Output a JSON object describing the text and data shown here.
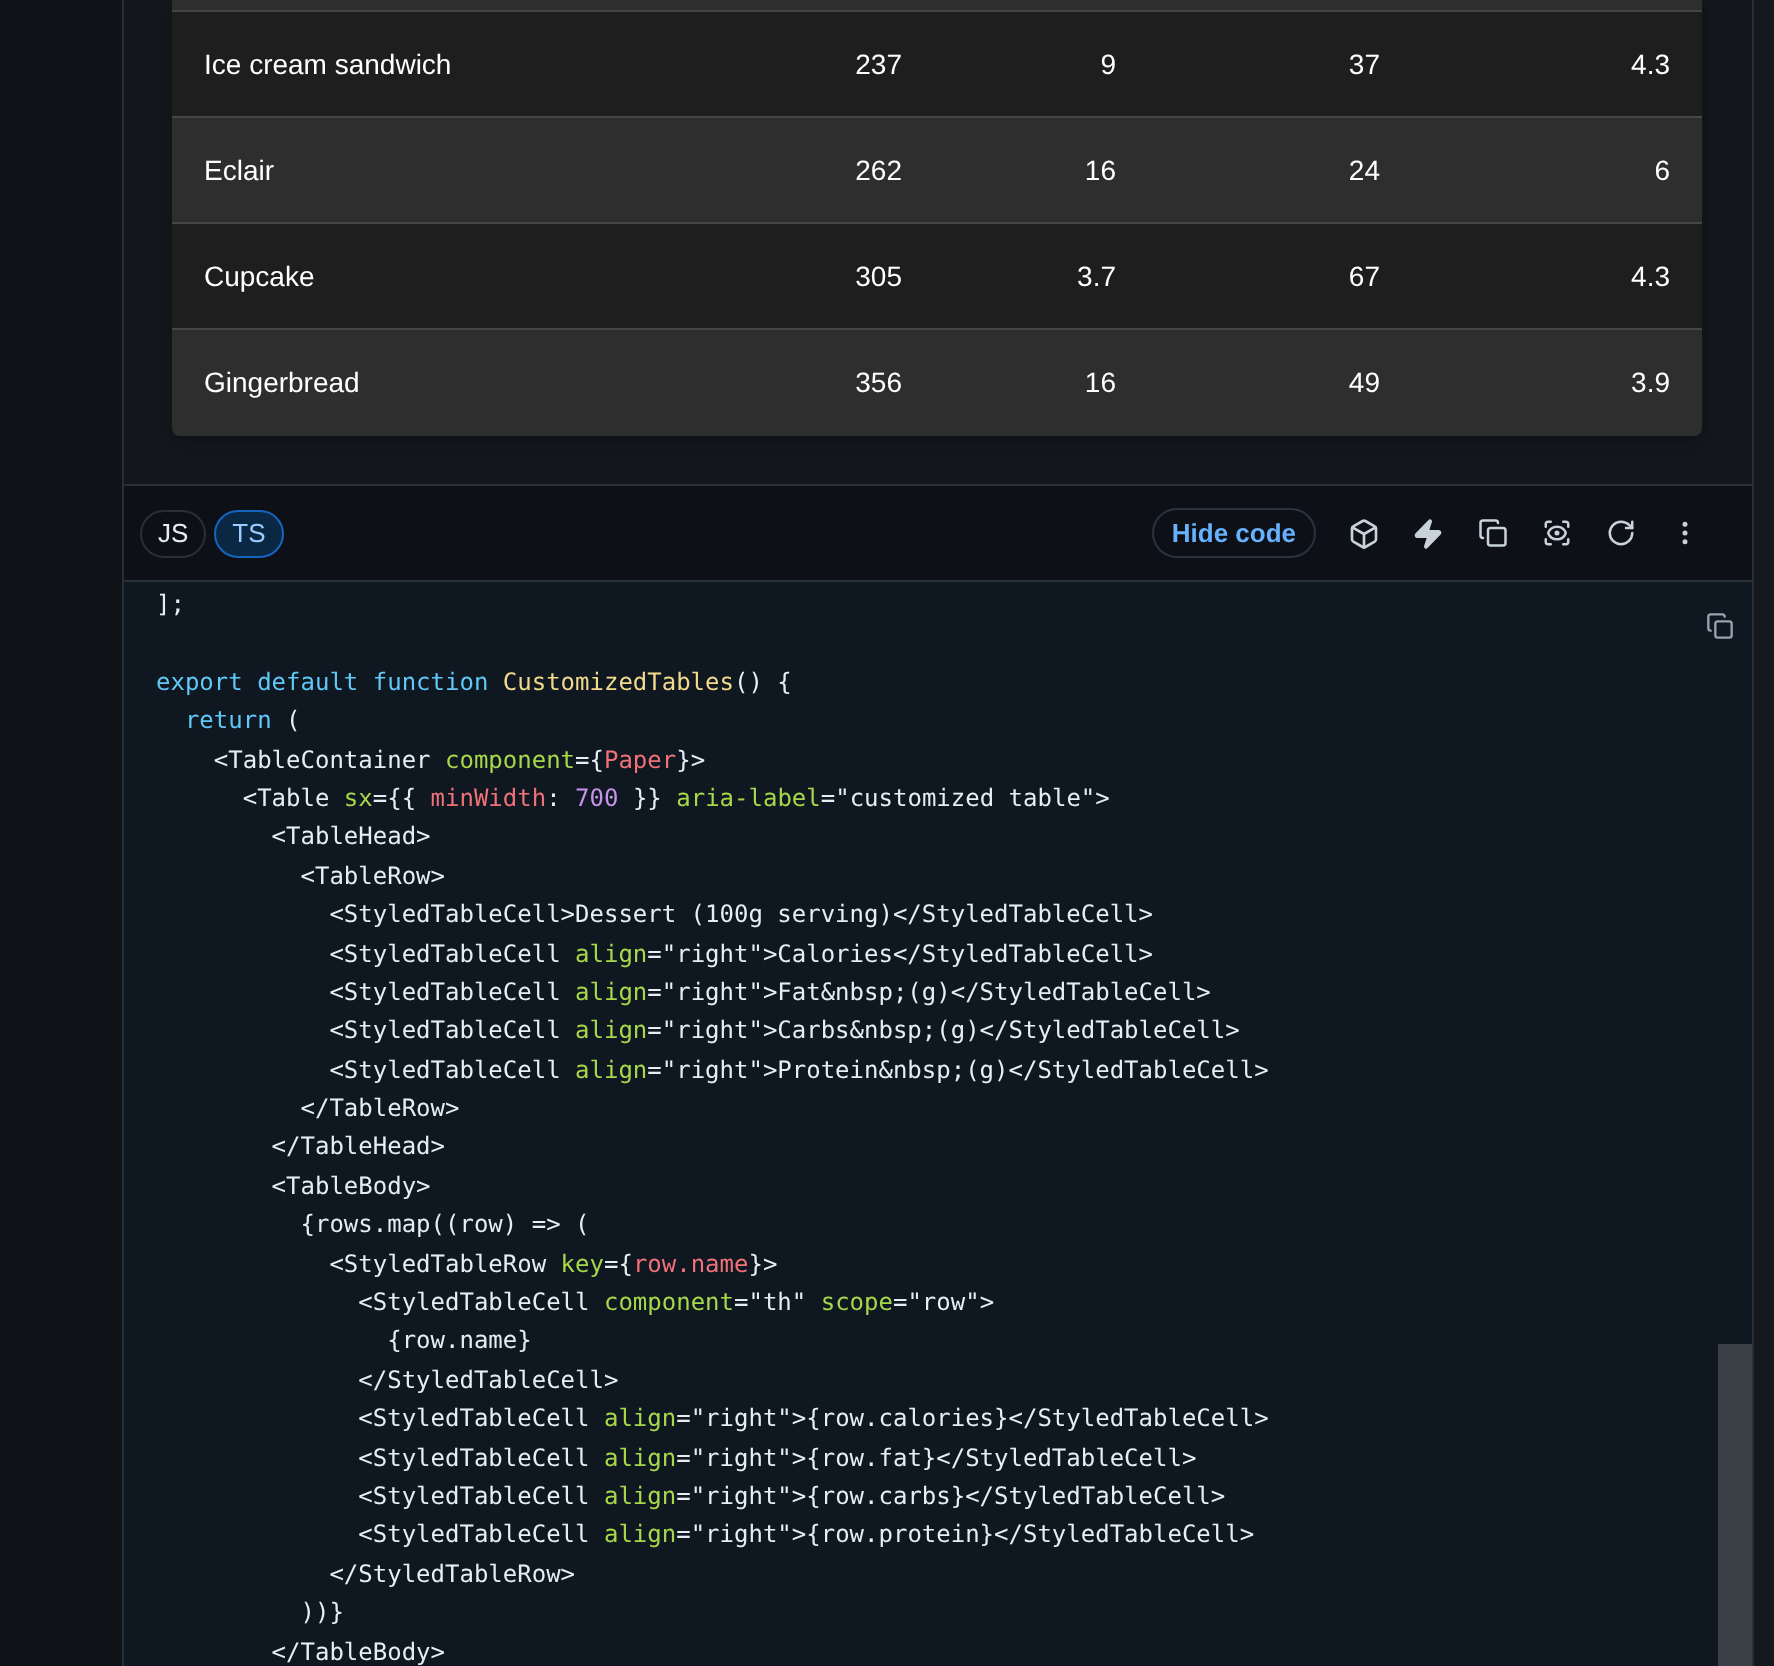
{
  "table": {
    "rows": [
      {
        "name": "Ice cream sandwich",
        "calories": "237",
        "fat": "9",
        "carbs": "37",
        "protein": "4.3"
      },
      {
        "name": "Eclair",
        "calories": "262",
        "fat": "16",
        "carbs": "24",
        "protein": "6"
      },
      {
        "name": "Cupcake",
        "calories": "305",
        "fat": "3.7",
        "carbs": "67",
        "protein": "4.3"
      },
      {
        "name": "Gingerbread",
        "calories": "356",
        "fat": "16",
        "carbs": "49",
        "protein": "3.9"
      }
    ]
  },
  "toolbar": {
    "languages": [
      {
        "label": "JS",
        "selected": false
      },
      {
        "label": "TS",
        "selected": true
      }
    ],
    "hide_code": "Hide code"
  },
  "code": {
    "lines": [
      [
        {
          "kind": "plain",
          "text": "];"
        }
      ],
      [
        {
          "kind": "blank"
        }
      ],
      [
        {
          "kind": "keyword",
          "text": "export default function "
        },
        {
          "kind": "fn",
          "text": "CustomizedTables"
        },
        {
          "kind": "plain",
          "text": "() {"
        }
      ],
      [
        {
          "kind": "keyword",
          "text": "  return "
        },
        {
          "kind": "plain",
          "text": "("
        }
      ],
      [
        {
          "kind": "plain",
          "text": "    <TableContainer "
        },
        {
          "kind": "attr",
          "text": "component"
        },
        {
          "kind": "plain",
          "text": "={"
        },
        {
          "kind": "var",
          "text": "Paper"
        },
        {
          "kind": "plain",
          "text": "}>"
        }
      ],
      [
        {
          "kind": "plain",
          "text": "      <Table "
        },
        {
          "kind": "attr",
          "text": "sx"
        },
        {
          "kind": "plain",
          "text": "={{ "
        },
        {
          "kind": "var",
          "text": "minWidth"
        },
        {
          "kind": "plain",
          "text": ": "
        },
        {
          "kind": "num",
          "text": "700"
        },
        {
          "kind": "plain",
          "text": " }} "
        },
        {
          "kind": "attr",
          "text": "aria-label"
        },
        {
          "kind": "plain",
          "text": "=\"customized table\">"
        }
      ],
      [
        {
          "kind": "plain",
          "text": "        <TableHead>"
        }
      ],
      [
        {
          "kind": "plain",
          "text": "          <TableRow>"
        }
      ],
      [
        {
          "kind": "plain",
          "text": "            <StyledTableCell>Dessert (100g serving)</StyledTableCell>"
        }
      ],
      [
        {
          "kind": "plain",
          "text": "            <StyledTableCell "
        },
        {
          "kind": "attr",
          "text": "align"
        },
        {
          "kind": "plain",
          "text": "=\"right\">Calories</StyledTableCell>"
        }
      ],
      [
        {
          "kind": "plain",
          "text": "            <StyledTableCell "
        },
        {
          "kind": "attr",
          "text": "align"
        },
        {
          "kind": "plain",
          "text": "=\"right\">Fat&nbsp;(g)</StyledTableCell>"
        }
      ],
      [
        {
          "kind": "plain",
          "text": "            <StyledTableCell "
        },
        {
          "kind": "attr",
          "text": "align"
        },
        {
          "kind": "plain",
          "text": "=\"right\">Carbs&nbsp;(g)</StyledTableCell>"
        }
      ],
      [
        {
          "kind": "plain",
          "text": "            <StyledTableCell "
        },
        {
          "kind": "attr",
          "text": "align"
        },
        {
          "kind": "plain",
          "text": "=\"right\">Protein&nbsp;(g)</StyledTableCell>"
        }
      ],
      [
        {
          "kind": "plain",
          "text": "          </TableRow>"
        }
      ],
      [
        {
          "kind": "plain",
          "text": "        </TableHead>"
        }
      ],
      [
        {
          "kind": "plain",
          "text": "        <TableBody>"
        }
      ],
      [
        {
          "kind": "plain",
          "text": "          {rows.map((row) => ("
        }
      ],
      [
        {
          "kind": "plain",
          "text": "            <StyledTableRow "
        },
        {
          "kind": "attr",
          "text": "key"
        },
        {
          "kind": "plain",
          "text": "={"
        },
        {
          "kind": "var",
          "text": "row.name"
        },
        {
          "kind": "plain",
          "text": "}>"
        }
      ],
      [
        {
          "kind": "plain",
          "text": "              <StyledTableCell "
        },
        {
          "kind": "attr",
          "text": "component"
        },
        {
          "kind": "plain",
          "text": "=\"th\" "
        },
        {
          "kind": "attr",
          "text": "scope"
        },
        {
          "kind": "plain",
          "text": "=\"row\">"
        }
      ],
      [
        {
          "kind": "plain",
          "text": "                {row.name}"
        }
      ],
      [
        {
          "kind": "plain",
          "text": "              </StyledTableCell>"
        }
      ],
      [
        {
          "kind": "plain",
          "text": "              <StyledTableCell "
        },
        {
          "kind": "attr",
          "text": "align"
        },
        {
          "kind": "plain",
          "text": "=\"right\">{row.calories}</StyledTableCell>"
        }
      ],
      [
        {
          "kind": "plain",
          "text": "              <StyledTableCell "
        },
        {
          "kind": "attr",
          "text": "align"
        },
        {
          "kind": "plain",
          "text": "=\"right\">{row.fat}</StyledTableCell>"
        }
      ],
      [
        {
          "kind": "plain",
          "text": "              <StyledTableCell "
        },
        {
          "kind": "attr",
          "text": "align"
        },
        {
          "kind": "plain",
          "text": "=\"right\">{row.carbs}</StyledTableCell>"
        }
      ],
      [
        {
          "kind": "plain",
          "text": "              <StyledTableCell "
        },
        {
          "kind": "attr",
          "text": "align"
        },
        {
          "kind": "plain",
          "text": "=\"right\">{row.protein}</StyledTableCell>"
        }
      ],
      [
        {
          "kind": "plain",
          "text": "            </StyledTableRow>"
        }
      ],
      [
        {
          "kind": "plain",
          "text": "          ))}"
        }
      ],
      [
        {
          "kind": "plain",
          "text": "        </TableBody>"
        }
      ]
    ]
  }
}
